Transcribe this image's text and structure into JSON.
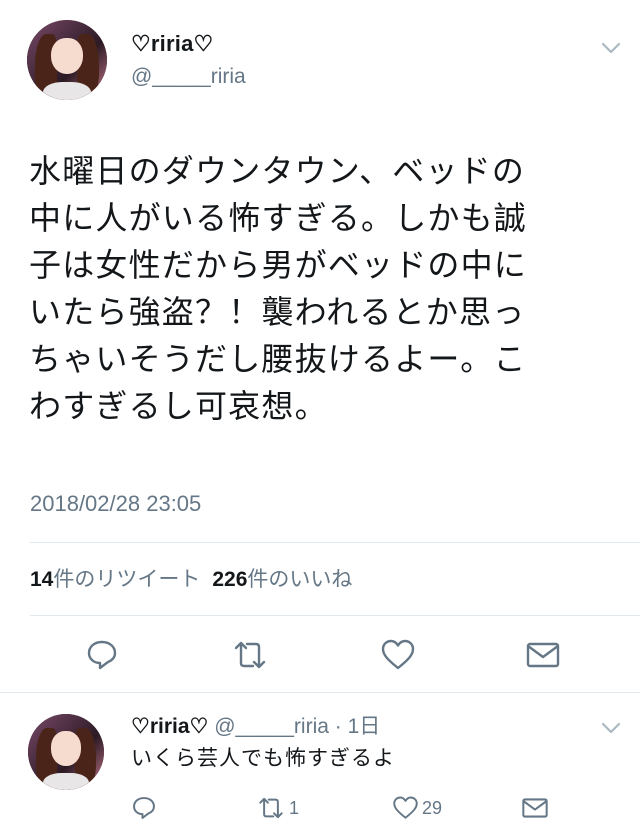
{
  "main_tweet": {
    "display_name": "♡riria♡",
    "handle": "@_____riria",
    "text_lines": [
      "水曜日のダウンタウン、ベッドの",
      "中に人がいる怖すぎる。しかも誠",
      "子は女性だから男がベッドの中に",
      "いたら強盗？！襲われるとか思っ",
      "ちゃいそうだし腰抜けるよー。こ",
      "わすぎるし可哀想。"
    ],
    "timestamp": "2018/02/28 23:05",
    "retweets_count": "14",
    "retweets_label": "件のリツイート",
    "likes_count": "226",
    "likes_label": "件のいいね",
    "icons": {
      "avatar": "avatar",
      "more": "chevron-down-icon",
      "reply": "reply-icon",
      "retweet": "retweet-icon",
      "like": "heart-icon",
      "share": "mail-icon"
    }
  },
  "reply_tweet": {
    "display_name": "♡riria♡",
    "meta": "@_____riria · 1日",
    "text": "いくら芸人でも怖すぎるよ",
    "retweet_count": "1",
    "like_count": "29"
  },
  "colors": {
    "text": "#14171a",
    "secondary": "#657786",
    "divider": "#e1e8ed",
    "icon": "#657786"
  }
}
